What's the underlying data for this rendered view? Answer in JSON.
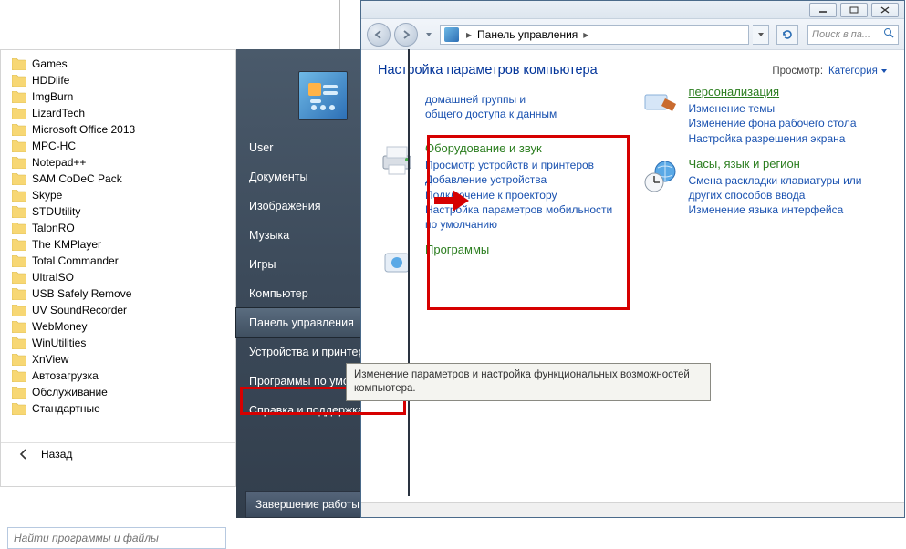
{
  "left": {
    "folders": [
      "Games",
      "HDDlife",
      "ImgBurn",
      "LizardTech",
      "Microsoft Office 2013",
      "MPC-HC",
      "Notepad++",
      "SAM CoDeC Pack",
      "Skype",
      "STDUtility",
      "TalonRO",
      "The KMPlayer",
      "Total Commander",
      "UltraISO",
      "USB Safely Remove",
      "UV SoundRecorder",
      "WebMoney",
      "WinUtilities",
      "XnView",
      "Автозагрузка",
      "Обслуживание",
      "Стандартные"
    ],
    "back": "Назад",
    "search_placeholder": "Найти программы и файлы"
  },
  "start_right": {
    "items": [
      "User",
      "Документы",
      "Изображения",
      "Музыка",
      "Игры",
      "Компьютер",
      "Панель управления",
      "Устройства и принтеры",
      "Программы по умолчанию",
      "Справка и поддержка"
    ],
    "highlighted_index": 6,
    "shutdown": "Завершение работы",
    "tooltip": "Изменение параметров и настройка функциональных возможностей компьютера."
  },
  "cp": {
    "breadcrumb": "Панель управления",
    "search_placeholder": "Поиск в па...",
    "title": "Настройка параметров компьютера",
    "view_label": "Просмотр:",
    "view_value": "Категория",
    "left_col": {
      "net_fragment1": "домашней группы и",
      "net_fragment2": "общего доступа к данным",
      "hw_title": "Оборудование и звук",
      "hw_links": [
        "Просмотр устройств и принтеров",
        "Добавление устройства",
        "Подключение к проектору",
        "Настройка параметров мобильности по умолчанию"
      ],
      "programs_fragment": "Программы"
    },
    "right_col": {
      "pers_title": "персонализация",
      "pers_links": [
        "Изменение темы",
        "Изменение фона рабочего стола",
        "Настройка разрешения экрана"
      ],
      "clock_title": "Часы, язык и регион",
      "clock_links": [
        "Смена раскладки клавиатуры или других способов ввода",
        "Изменение языка интерфейса"
      ]
    }
  }
}
